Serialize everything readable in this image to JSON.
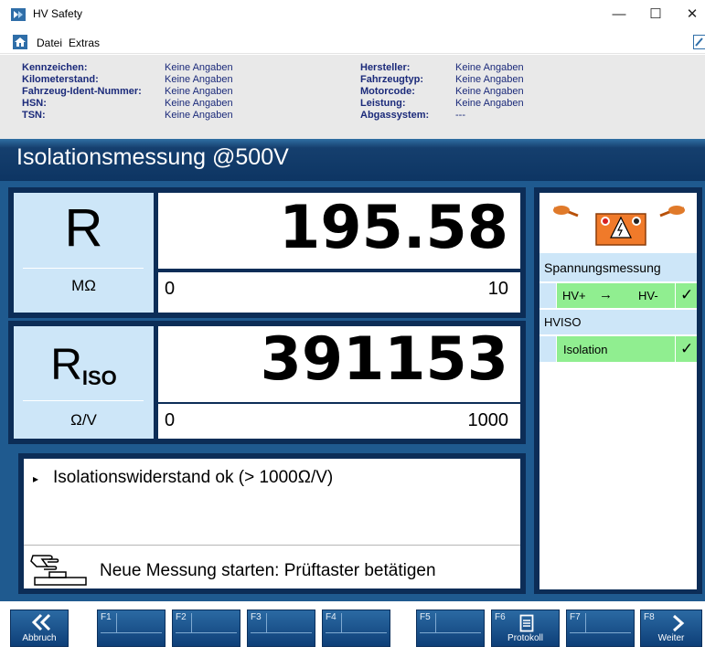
{
  "window": {
    "title": "HV Safety",
    "minimize": "—",
    "maximize": "☐",
    "close": "✕"
  },
  "menu": {
    "file": "Datei",
    "extras": "Extras"
  },
  "vehicle": {
    "left": [
      {
        "label": "Kennzeichen:",
        "value": "Keine Angaben"
      },
      {
        "label": "Kilometerstand:",
        "value": "Keine Angaben"
      },
      {
        "label": "Fahrzeug-Ident-Nummer:",
        "value": "Keine Angaben"
      },
      {
        "label": "HSN:",
        "value": "Keine Angaben"
      },
      {
        "label": "TSN:",
        "value": "Keine Angaben"
      }
    ],
    "right": [
      {
        "label": "Hersteller:",
        "value": "Keine Angaben"
      },
      {
        "label": "Fahrzeugtyp:",
        "value": "Keine Angaben"
      },
      {
        "label": "Motorcode:",
        "value": "Keine Angaben"
      },
      {
        "label": "Leistung:",
        "value": "Keine Angaben"
      },
      {
        "label": "Abgassystem:",
        "value": "---"
      }
    ]
  },
  "header": {
    "title": "Isolationsmessung @500V"
  },
  "measurement_r": {
    "symbol": "R",
    "value": "195.58",
    "unit": "MΩ",
    "scale_min": "0",
    "scale_max": "10"
  },
  "measurement_riso": {
    "symbol": "R",
    "subscript": "ISO",
    "value": "391153",
    "unit": "Ω/V",
    "scale_min": "0",
    "scale_max": "1000"
  },
  "message": {
    "result": "Isolationswiderstand ok (> 1000Ω/V)",
    "instruction": "Neue Messung starten: Prüftaster betätigen"
  },
  "steps": {
    "group1_title": "Spannungsmessung",
    "step1_from": "HV+",
    "step1_arrow": "→",
    "step1_to": "HV-",
    "step1_check": "✓",
    "group2_title": "HVISO",
    "step2_label": "Isolation",
    "step2_check": "✓"
  },
  "toolbar": {
    "cancel_label": "Abbruch",
    "f1": "F1",
    "f2": "F2",
    "f3": "F3",
    "f4": "F4",
    "f5": "F5",
    "f6": "F6",
    "f7": "F7",
    "f8": "F8",
    "protocol_label": "Protokoll",
    "next_label": "Weiter"
  },
  "colors": {
    "header_blue": "#0d3563",
    "panel_navy": "#0c2d57",
    "cell_light_blue": "#cde6f8",
    "step_green": "#90ee90",
    "label_blue": "#1b2a7a",
    "fkey_blue": "#1a5591"
  }
}
